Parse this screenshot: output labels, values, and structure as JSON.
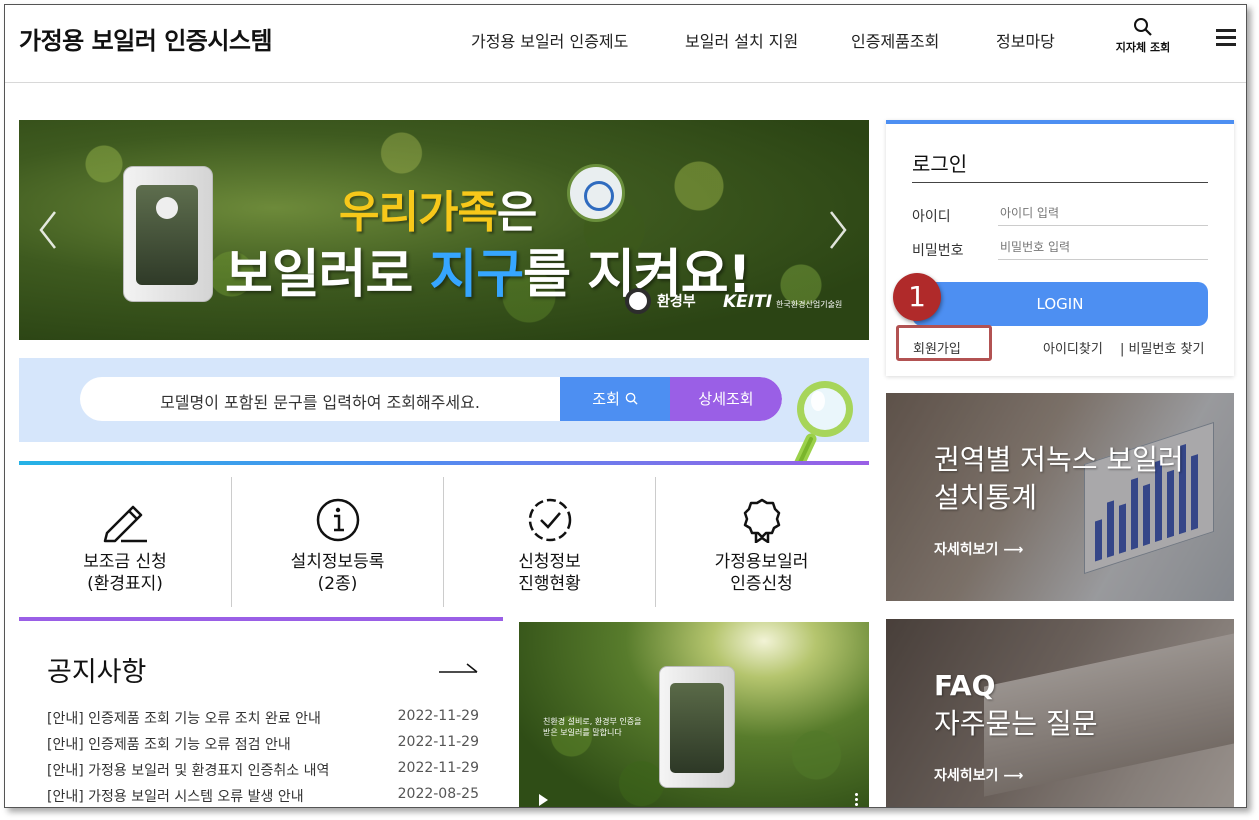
{
  "header": {
    "site_title": "가정용 보일러 인증시스템",
    "nav": [
      "가정용 보일러 인증제도",
      "보일러 설치 지원",
      "인증제품조회",
      "정보마당"
    ],
    "region_search_label": "지자체 조회"
  },
  "banner": {
    "line1_a": "우리가족",
    "line1_b": "은",
    "line2_a": "보일러로 ",
    "line2_b": "지구",
    "line2_c": "를 지켜요!",
    "logo_ministry": "환경부",
    "logo_keiti": "KEITI",
    "logo_keiti_sub": "한국환경산업기술원"
  },
  "search": {
    "placeholder": "모델명이 포함된 문구를 입력하여 조회해주세요.",
    "search_label": "조회",
    "detail_label": "상세조회"
  },
  "quick_menu": [
    {
      "line1": "보조금 신청",
      "line2": "(환경표지)"
    },
    {
      "line1": "설치정보등록",
      "line2": "(2종)"
    },
    {
      "line1": "신청정보",
      "line2": "진행현황"
    },
    {
      "line1": "가정용보일러",
      "line2": "인증신청"
    }
  ],
  "notice": {
    "title": "공지사항",
    "items": [
      {
        "title": "[안내] 인증제품 조회 기능 오류 조치 완료 안내",
        "date": "2022-11-29"
      },
      {
        "title": "[안내] 인증제품 조회 기능 오류 점검 안내",
        "date": "2022-11-29"
      },
      {
        "title": "[안내] 가정용 보일러 및 환경표지 인증취소 내역",
        "date": "2022-11-29"
      },
      {
        "title": "[안내] 가정용 보일러 시스템 오류 발생 안내",
        "date": "2022-08-25"
      }
    ]
  },
  "video": {
    "caption_line1": "친환경 설비로,  환경부 인증을",
    "caption_line2": "받은 보일러를 말합니다"
  },
  "login": {
    "title": "로그인",
    "id_label": "아이디",
    "id_placeholder": "아이디 입력",
    "pw_label": "비밀번호",
    "pw_placeholder": "비밀번호 입력",
    "button": "LOGIN",
    "signup": "회원가입",
    "find_id": "아이디찾기",
    "find_pw": "| 비밀번호 찾기"
  },
  "annotation": {
    "step_number": "1",
    "marker_color": "#b02a2a"
  },
  "promos": [
    {
      "title_line1": "권역별 저녹스 보일러",
      "title_line2": "설치통계",
      "link": "자세히보기 ⟶"
    },
    {
      "title_line1": "FAQ",
      "title_line2": "자주묻는 질문",
      "link": "자세히보기 ⟶"
    }
  ],
  "colors": {
    "accent_blue": "#4d8ff2",
    "accent_purple": "#9a5fe6",
    "search_strip_bg": "#d6e6fb"
  }
}
